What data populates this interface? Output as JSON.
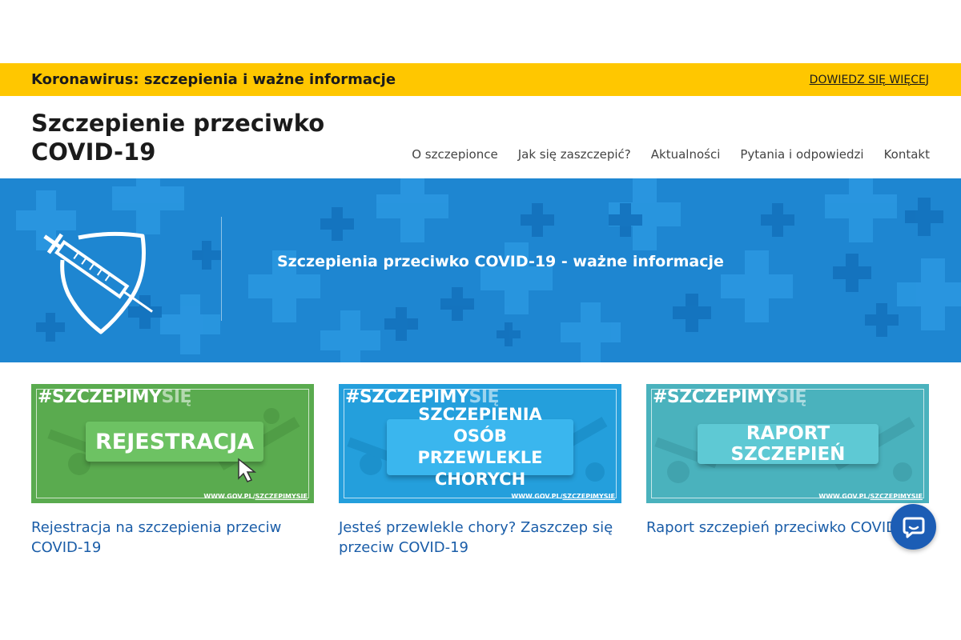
{
  "alert": {
    "title": "Koronawirus: szczepienia i ważne informacje",
    "link": "DOWIEDZ SIĘ WIĘCEJ"
  },
  "header": {
    "site_title": "Szczepienie przeciwko COVID-19",
    "nav": [
      "O szczepionce",
      "Jak się zaszczepić?",
      "Aktualności",
      "Pytania i odpowiedzi",
      "Kontakt"
    ]
  },
  "hero": {
    "title": "Szczepienia przeciwko COVID-19 - ważne informacje",
    "icon": "syringe-shield-icon"
  },
  "cards": [
    {
      "hashtag_main": "#SZCZEPIMY",
      "hashtag_light": "SIĘ",
      "label": "REJESTRACJA",
      "url_prefix": "WWW.GOV.PL/",
      "url_bold": "SZCZEPIMYSIE",
      "text": "Rejestracja na szczepienia przeciw COVID-19",
      "color": "#5aab4f",
      "box_color": "#6dc263"
    },
    {
      "hashtag_main": "#SZCZEPIMY",
      "hashtag_light": "SIĘ",
      "label": "SZCZEPIENIA OSÓB PRZEWLEKLE CHORYCH",
      "url_prefix": "WWW.GOV.PL/",
      "url_bold": "SZCZEPIMYSIE",
      "text": "Jesteś przewlekle chory? Zaszczep się przeciw COVID-19",
      "color": "#249fdc",
      "box_color": "#3ab6ee"
    },
    {
      "hashtag_main": "#SZCZEPIMY",
      "hashtag_light": "SIĘ",
      "label": "RAPORT SZCZEPIEŃ",
      "url_prefix": "WWW.GOV.PL/",
      "url_bold": "SZCZEPIMYSIE",
      "text": "Raport szczepień przeciwko COVID-19",
      "color": "#4ab2bd",
      "box_color": "#5ec9d4"
    }
  ],
  "chat": {
    "icon": "chat-bubble-icon"
  }
}
